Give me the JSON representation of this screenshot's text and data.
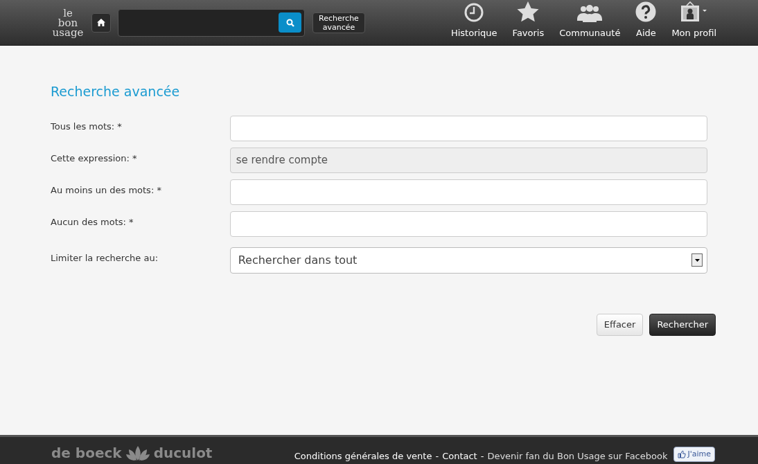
{
  "header": {
    "logo": [
      "le",
      "bon",
      "usage"
    ],
    "advanced_button": "Recherche avancée",
    "nav": [
      {
        "kind": "clock",
        "label": "Historique"
      },
      {
        "kind": "star",
        "label": "Favoris"
      },
      {
        "kind": "people",
        "label": "Communauté"
      },
      {
        "kind": "help",
        "label": "Aide"
      },
      {
        "kind": "profile",
        "label": "Mon profil"
      }
    ]
  },
  "form": {
    "title": "Recherche avancée",
    "fields": [
      {
        "kind": "input",
        "label": "Tous les mots: *",
        "disabled": false
      },
      {
        "kind": "input",
        "label": "Cette expression: *",
        "value": "se rendre compte",
        "disabled": true
      },
      {
        "kind": "input",
        "label": "Au moins un des mots: *",
        "disabled": false
      },
      {
        "kind": "input",
        "label": "Aucun des mots: *",
        "disabled": false
      },
      {
        "kind": "select",
        "label": "Limiter la recherche au:",
        "value": "Rechercher dans tout"
      }
    ],
    "buttons": [
      {
        "kind": "secondary",
        "label": "Effacer"
      },
      {
        "kind": "primary",
        "label": "Rechercher"
      }
    ]
  },
  "footer": {
    "brand": [
      "de boeck",
      "duculot"
    ],
    "links": [
      "Conditions générales de vente",
      "Contact",
      "Devenir fan du Bon Usage sur Facebook"
    ],
    "separators": [
      "-",
      "-"
    ],
    "like_button": "J'aime"
  }
}
